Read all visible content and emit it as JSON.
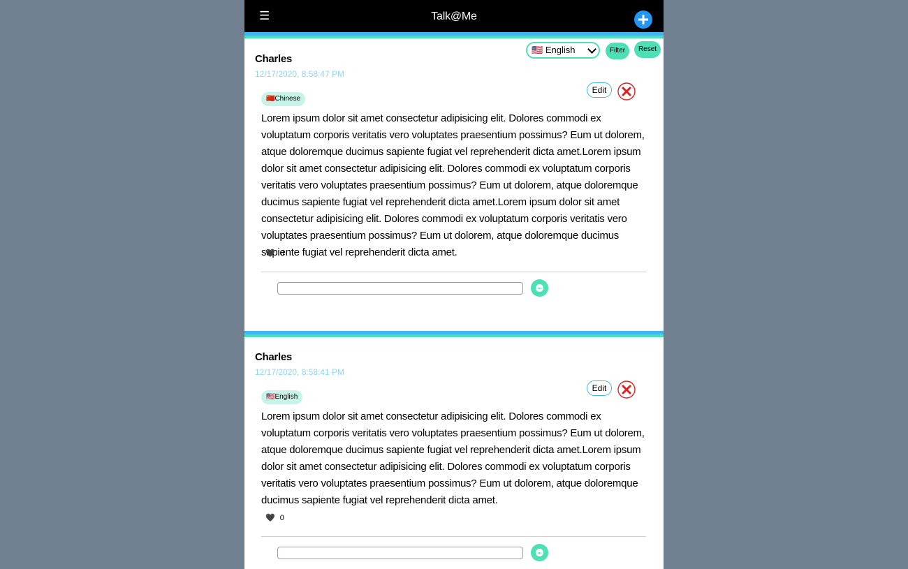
{
  "navbar": {
    "menu_glyph": "☰",
    "title": "Talk@Me",
    "add_icon": "plus-circle-icon"
  },
  "filter_bar": {
    "language_flag": "🇺🇸",
    "language_value": "English",
    "filter_label": "Filter",
    "reset_label": "Reset"
  },
  "posts": [
    {
      "author": "Charles",
      "timestamp": "12/17/2020, 8:58:47 PM",
      "language_flag": "🇨🇳",
      "language": "Chinese",
      "edit_label": "Edit",
      "body": "Lorem ipsum dolor sit amet consectetur adipisicing elit. Dolores commodi ex voluptatum corporis veritatis vero voluptates praesentium possimus? Eum ut dolorem, atque doloremque ducimus sapiente fugiat vel reprehenderit dicta amet.Lorem ipsum dolor sit amet consectetur adipisicing elit. Dolores commodi ex voluptatum corporis veritatis vero voluptates praesentium possimus? Eum ut dolorem, atque doloremque ducimus sapiente fugiat vel reprehenderit dicta amet.Lorem ipsum dolor sit amet consectetur adipisicing elit. Dolores commodi ex voluptatum corporis veritatis vero voluptates praesentium possimus? Eum ut dolorem, atque doloremque ducimus sapiente fugiat vel reprehenderit dicta amet.",
      "likes": "0",
      "heart_glyph": "🖤",
      "comment_value": ""
    },
    {
      "author": "Charles",
      "timestamp": "12/17/2020, 8:58:41 PM",
      "language_flag": "🇺🇸",
      "language": "English",
      "edit_label": "Edit",
      "body": "Lorem ipsum dolor sit amet consectetur adipisicing elit. Dolores commodi ex voluptatum corporis veritatis vero voluptates praesentium possimus? Eum ut dolorem, atque doloremque ducimus sapiente fugiat vel reprehenderit dicta amet.Lorem ipsum dolor sit amet consectetur adipisicing elit. Dolores commodi ex voluptatum corporis veritatis vero voluptates praesentium possimus? Eum ut dolorem, atque doloremque ducimus sapiente fugiat vel reprehenderit dicta amet.",
      "likes": "0",
      "heart_glyph": "🖤",
      "comment_value": ""
    }
  ],
  "colors": {
    "page_background": "#708090",
    "navbar": "#000000",
    "accent_blue": "#3fb6ef",
    "accent_green": "#4ee0b5",
    "add_button": "#2196f3",
    "delete_red": "#e02020"
  }
}
